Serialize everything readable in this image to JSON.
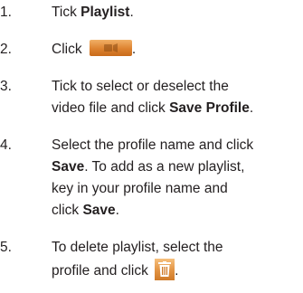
{
  "steps": [
    {
      "number": "1.",
      "lines": [
        {
          "pre": "Tick ",
          "bold": "Playlist",
          "post": "."
        }
      ]
    },
    {
      "number": "2.",
      "lines": [
        {
          "pre": "Click ",
          "icon": "playlist-save-icon",
          "post": "."
        }
      ]
    },
    {
      "number": "3.",
      "lines": [
        {
          "pre": "Tick to select or deselect the"
        },
        {
          "pre": "video file and click ",
          "bold": "Save Profile",
          "post": "."
        }
      ]
    },
    {
      "number": "4.",
      "lines": [
        {
          "pre": "Select the profile name and click"
        },
        {
          "bold": "Save",
          "post": ". To add as a new playlist,"
        },
        {
          "pre": "key in your profile name and"
        },
        {
          "pre": "click ",
          "bold": "Save",
          "post": "."
        }
      ]
    },
    {
      "number": "5.",
      "lines": [
        {
          "pre": "To delete playlist, select the"
        },
        {
          "pre": "profile and click ",
          "icon": "trash-icon",
          "post": "."
        }
      ]
    }
  ],
  "colors": {
    "text": "#231f20",
    "icon_orange": "#dd8330"
  }
}
